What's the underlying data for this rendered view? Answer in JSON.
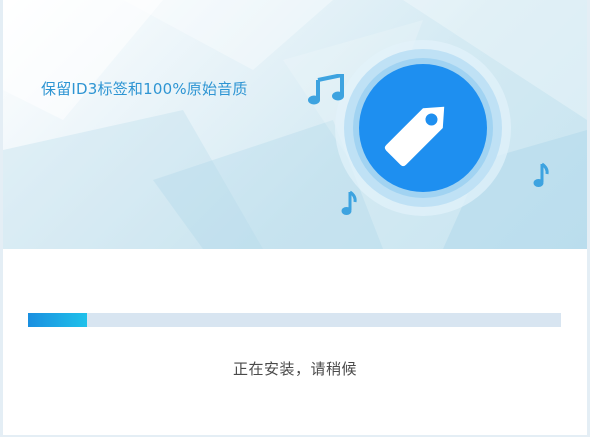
{
  "banner": {
    "tagline": "保留ID3标签和100%原始音质",
    "badge_icon": "price-tag-icon",
    "note_icons": [
      "music-note-icon",
      "music-note-icon",
      "music-note-icon"
    ],
    "colors": {
      "tagline": "#2e95d3",
      "badge_outer": "#bfe1f5",
      "badge_inner": "#1e8ff0",
      "note": "#3da3e0"
    }
  },
  "install": {
    "progress_fraction": 0.11,
    "status_text": "正在安装，请稍候",
    "colors": {
      "track": "#d8e5f1",
      "fill_start": "#1a8fe0",
      "fill_end": "#1fc1ea"
    }
  }
}
